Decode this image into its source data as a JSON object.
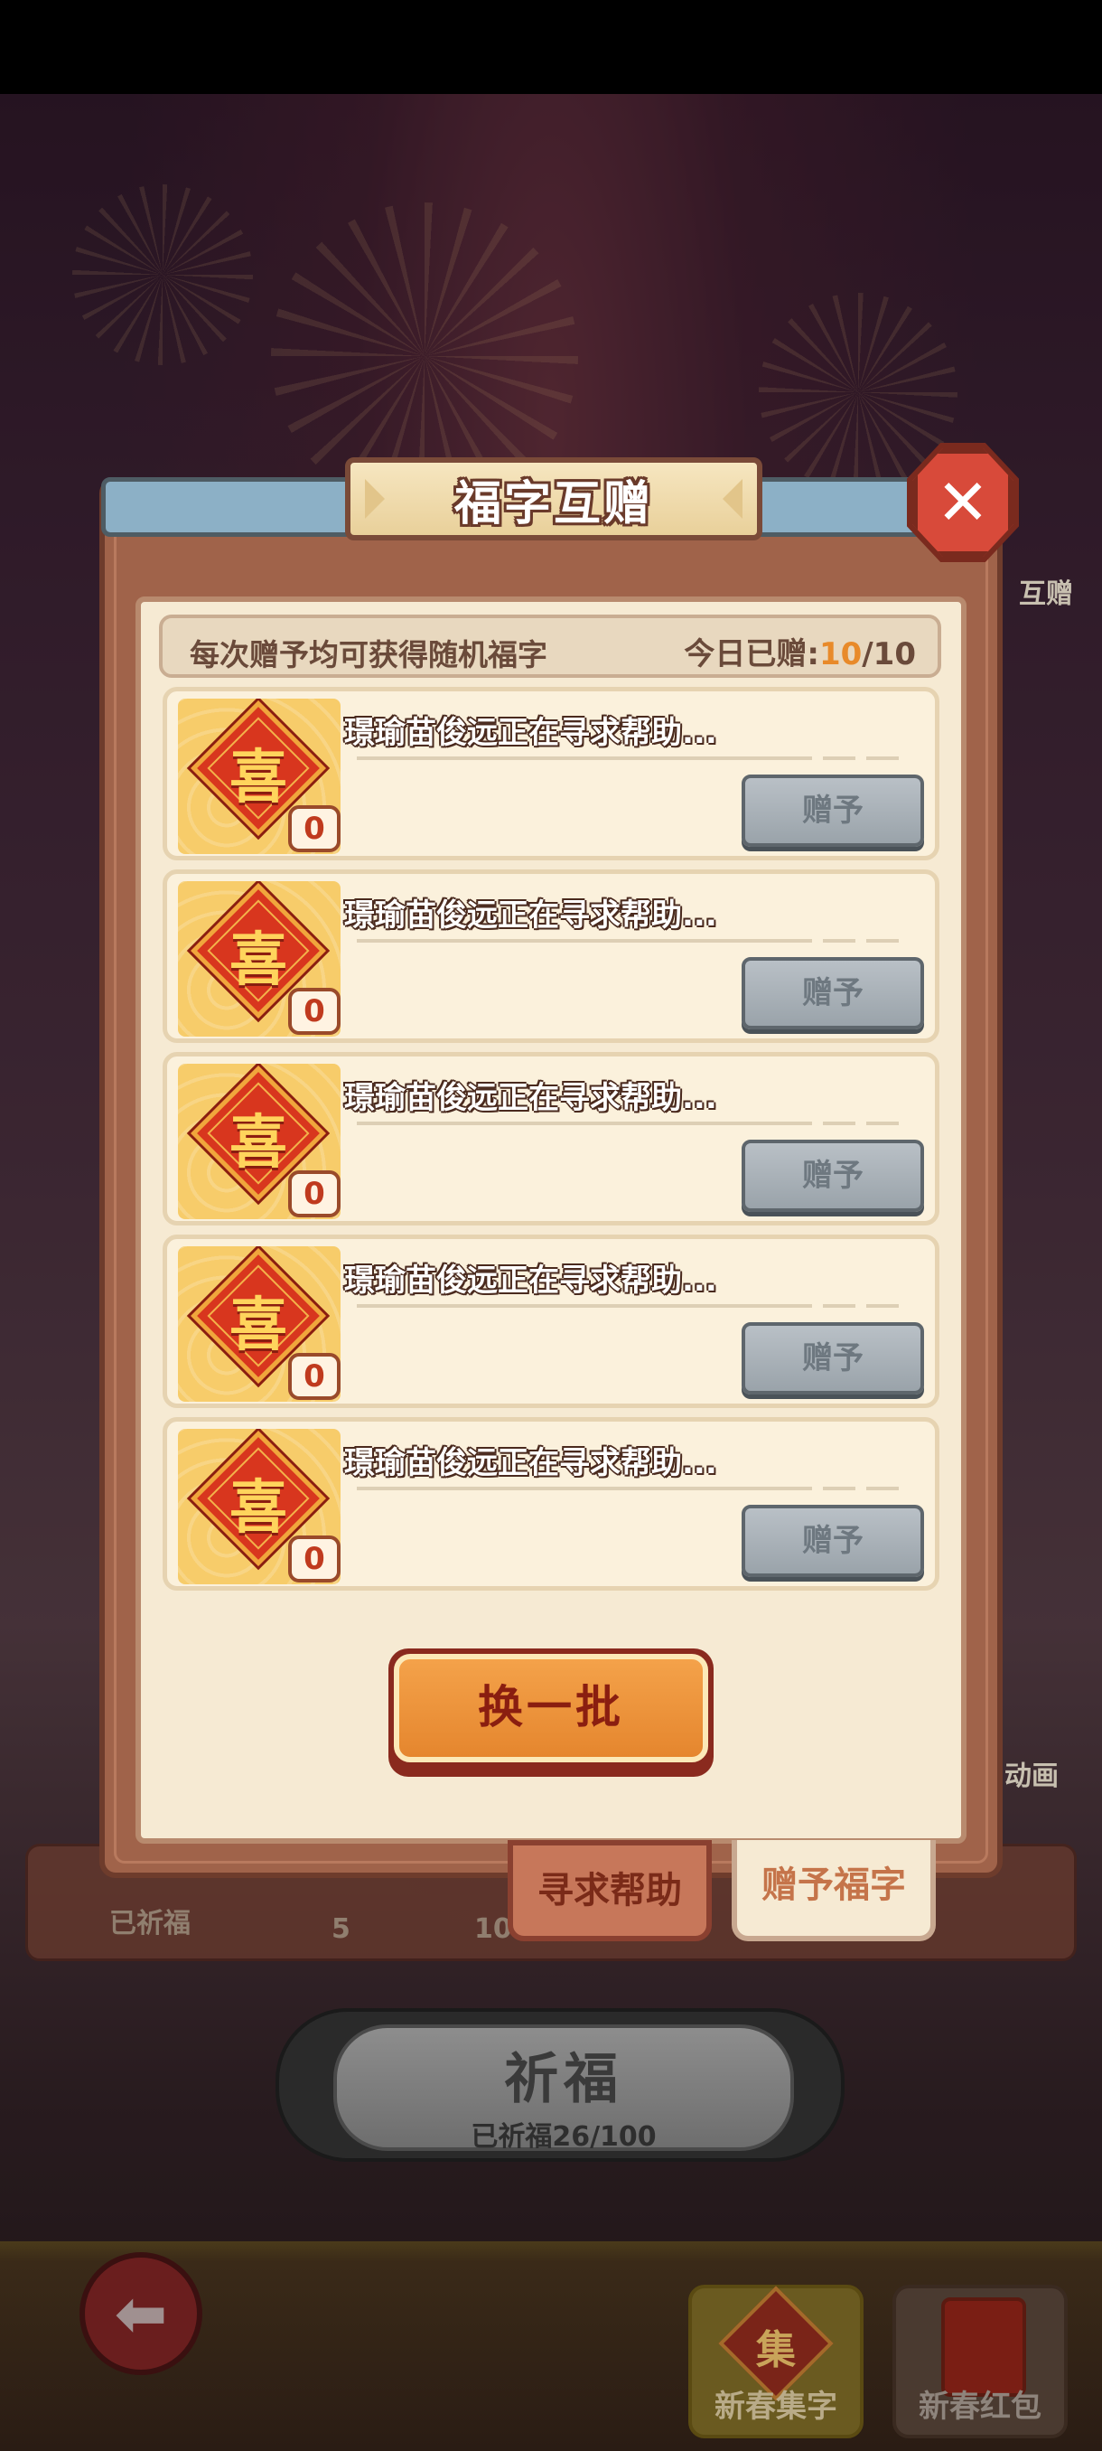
{
  "background": {
    "side_label_right_top": "互赠",
    "side_label_right_mid": "动画",
    "tier_labels": [
      "已祈福",
      "5",
      "10"
    ],
    "bless_button": {
      "title": "祈福",
      "subtitle": "已祈福26/100"
    },
    "bottom_nav": [
      {
        "label": "新春集字",
        "icon_char": "集"
      },
      {
        "label": "新春红包"
      }
    ]
  },
  "dialog": {
    "title": "福字互赠",
    "info": {
      "left_text": "每次赠予均可获得随机福字",
      "right_prefix": "今日已赠:",
      "given": "10",
      "total": "/10"
    },
    "rows": [
      {
        "glyph": "喜",
        "count": "0",
        "text": "璟瑜苗俊远正在寻求帮助...",
        "button": "赠予"
      },
      {
        "glyph": "喜",
        "count": "0",
        "text": "璟瑜苗俊远正在寻求帮助...",
        "button": "赠予"
      },
      {
        "glyph": "喜",
        "count": "0",
        "text": "璟瑜苗俊远正在寻求帮助...",
        "button": "赠予"
      },
      {
        "glyph": "喜",
        "count": "0",
        "text": "璟瑜苗俊远正在寻求帮助...",
        "button": "赠予"
      },
      {
        "glyph": "喜",
        "count": "0",
        "text": "璟瑜苗俊远正在寻求帮助...",
        "button": "赠予"
      }
    ],
    "refresh_label": "换一批",
    "tabs": [
      {
        "label": "寻求帮助",
        "active": false
      },
      {
        "label": "赠予福字",
        "active": true
      }
    ]
  },
  "colors": {
    "accent_orange": "#e88a2a",
    "give_button_disabled": "#9aa3aa",
    "glyph_red": "#d8361e"
  }
}
